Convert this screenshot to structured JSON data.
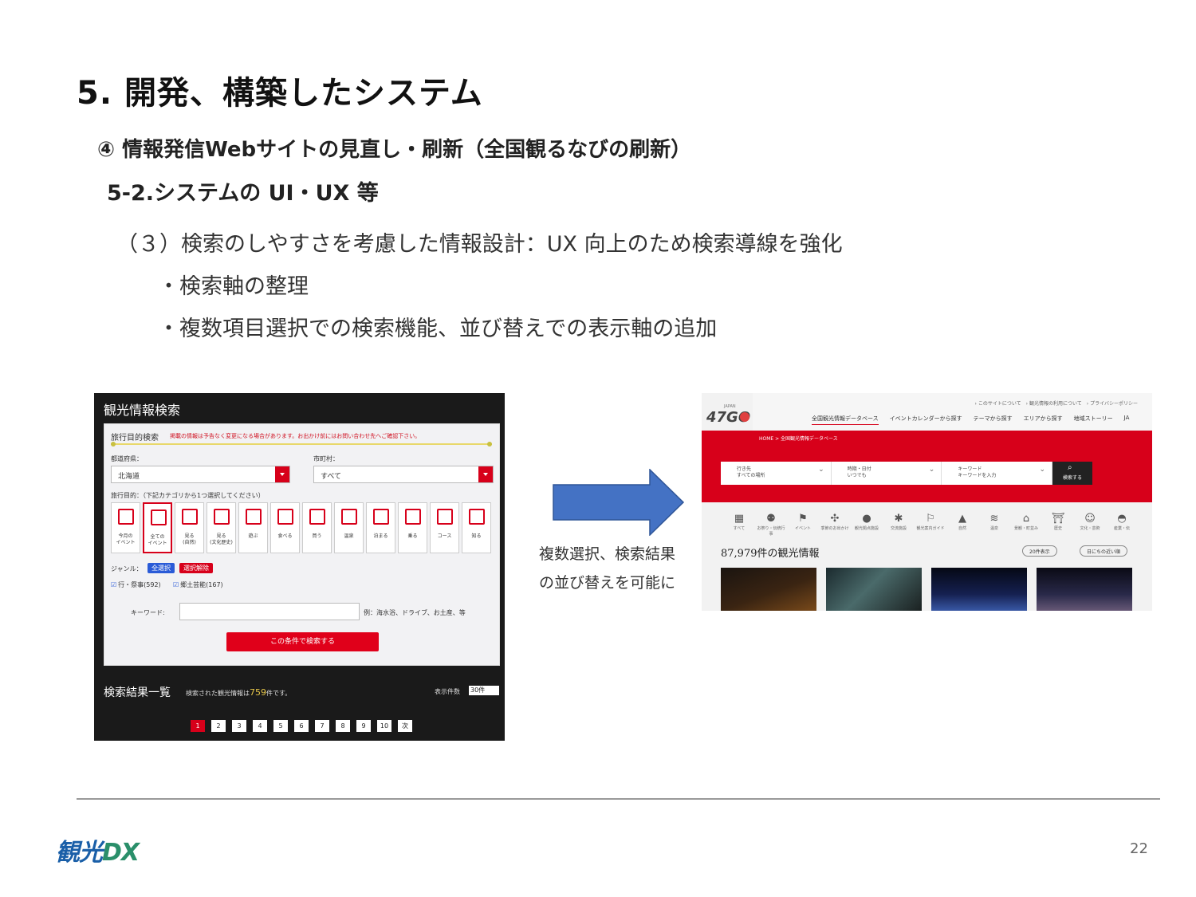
{
  "slide": {
    "title": "5. 開発、構築したシステム",
    "subtitle": "④ 情報発信Webサイトの見直し・刷新（全国観るなびの刷新）",
    "section": "5-2.システムの UI・UX 等",
    "points": [
      "（３）検索のしやすさを考慮した情報設計：UX 向上のため検索導線を強化",
      "・検索軸の整理",
      "・複数項目選択での検索機能、並び替えでの表示軸の追加"
    ],
    "arrow_note": [
      "複数選択、検索結果",
      "の並び替えを可能に"
    ],
    "page_number": "22",
    "logo": {
      "kanji": "観光",
      "dx": "DX"
    }
  },
  "left_screenshot": {
    "title": "観光情報検索",
    "panel_head": "旅行目的検索",
    "notice": "掲載の情報は予告なく変更になる場合があります。お出かけ前にはお問い合わせ先へご確認下さい。",
    "prefecture_label": "都道府県：",
    "prefecture_value": "北海道",
    "city_label": "市町村：",
    "city_value": "すべて",
    "purpose_label": "旅行目的：（下記カテゴリから1つ選択してください）",
    "categories": [
      "今月の\nイベント",
      "全ての\nイベント",
      "見る\n(自然)",
      "見る\n(文化歴史)",
      "遊ぶ",
      "食べる",
      "買う",
      "温泉",
      "泊まる",
      "乗る",
      "コース",
      "知る"
    ],
    "genre_label": "ジャンル：",
    "select_all": "全選択",
    "deselect": "選択解除",
    "checks": [
      "行・祭事(592)",
      "郷土芸能(167)"
    ],
    "keyword_label": "キーワード:",
    "keyword_example": "例：海水浴、ドライブ、お土産、等",
    "search_button": "この条件で検索する",
    "results_title": "検索結果一覧",
    "results_prefix": "検索された観光情報は",
    "results_count": "759",
    "results_suffix": "件です。",
    "display_label": "表示件数",
    "display_value": "30件",
    "pages": [
      "1",
      "2",
      "3",
      "4",
      "5",
      "6",
      "7",
      "8",
      "9",
      "10",
      "次"
    ],
    "accent_color": "#d7001a"
  },
  "right_screenshot": {
    "logo_text": "47GO",
    "logo_japan": "JAPAN",
    "top_links": "› このサイトについて　› 観光情報の利用について　› プライバシーポリシー",
    "nav": [
      "全国観光情報データベース",
      "イベントカレンダーから探す",
      "テーマから探す",
      "エリアから探す",
      "地域ストーリー",
      "JA"
    ],
    "breadcrumb": "HOME > 全国観光情報データベース",
    "fields": [
      {
        "label": "行き先",
        "value": "すべての場所"
      },
      {
        "label": "時期・日付",
        "value": "いつでも"
      },
      {
        "label": "キーワード",
        "value": "キーワードを入力"
      }
    ],
    "search_button": "検索する",
    "icons": [
      "すべて",
      "お祭り・伝統行事",
      "イベント",
      "季節のお出かけ",
      "観光拠点施設",
      "交流施設",
      "観光案内ガイド",
      "自然",
      "温泉",
      "景観・町並み",
      "歴史",
      "文化・芸術",
      "産業・伝"
    ],
    "count_text": "87,979件の観光情報",
    "sort_options": [
      "20件表示",
      "日にちの近い順"
    ]
  }
}
